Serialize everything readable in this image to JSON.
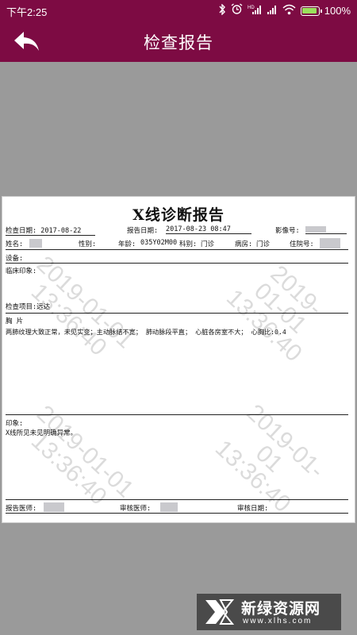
{
  "status_bar": {
    "time": "下午2:25",
    "battery_percent": "100%",
    "icons": [
      "bluetooth-icon",
      "alarm-icon",
      "signal-hd-icon",
      "signal-icon",
      "wifi-icon",
      "battery-icon"
    ]
  },
  "header": {
    "title": "检查报告",
    "back_icon": "back-arrow-icon",
    "bg_color": "#7d0b43"
  },
  "report": {
    "title": "X线诊断报告",
    "exam_date_label": "检查日期:",
    "exam_date": "2017-08-22",
    "report_date_label": "报告日期:",
    "report_date": "2017-08-23 08:47",
    "image_no_label": "影像号:",
    "name_label": "姓名:",
    "gender_label": "性别:",
    "age_label": "年龄:",
    "age": "035Y02M00",
    "dept_label": "科别:",
    "dept": "门诊",
    "ward_label": "病房:",
    "ward": "门诊",
    "admission_label": "住院号:",
    "device_label": "设备:",
    "clinical_label": "临床印象:",
    "item_label": "检查项目:",
    "item": "远达",
    "film_label": "胸 片",
    "findings": "两肺纹理大致正常，未见实变；主动脉结不宽；  肺动脉段平直；  心脏各房室不大；  心胸比:0.4",
    "impression_label": "印象:",
    "impression": "X线所见未见明确异常。",
    "doctor_label": "报告医师:",
    "reviewer_label": "审核医师:",
    "review_date_label": "审核日期:"
  },
  "watermark": {
    "date": "2019-01-01",
    "time": "13:36:40"
  },
  "brand": {
    "name": "新绿资源网",
    "url": "www.xlhs.com"
  }
}
